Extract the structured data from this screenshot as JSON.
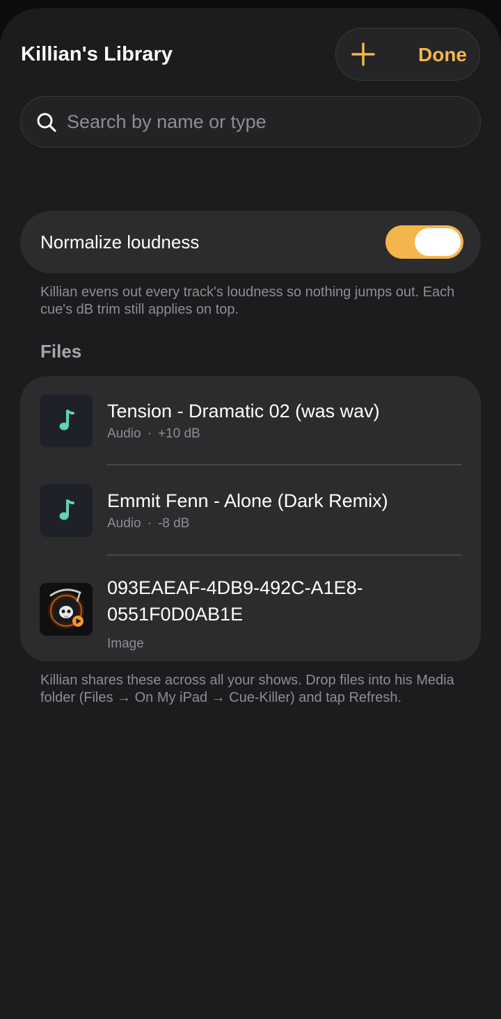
{
  "header": {
    "title": "Killian's Library",
    "add_icon": "plus-icon",
    "done_label": "Done"
  },
  "search": {
    "placeholder": "Search by name or type",
    "value": ""
  },
  "normalize": {
    "label": "Normalize loudness",
    "enabled": true,
    "footnote": "Killian evens out every track's loudness so nothing jumps out. Each cue's dB trim still applies on top."
  },
  "files": {
    "header": "Files",
    "items": [
      {
        "name": "Tension - Dramatic 02 (was wav)",
        "type": "Audio",
        "separator": "·",
        "gain": "+10 dB",
        "icon": "music-note-icon"
      },
      {
        "name": "Emmit Fenn - Alone (Dark Remix)",
        "type": "Audio",
        "separator": "·",
        "gain": "-8 dB",
        "icon": "music-note-icon"
      },
      {
        "name": "093EAEAF-4DB9-492C-A1E8-0551F0D0AB1E",
        "type": "Image",
        "icon": "image-thumbnail"
      }
    ],
    "footnote": "Killian shares these across all your shows. Drop files into his Media folder (Files → On My iPad → Cue-Killer) and tap Refresh."
  },
  "colors": {
    "accent": "#f5b54d",
    "note": "#5fd3b4",
    "background": "#1c1c1e",
    "card": "#2c2c2e"
  }
}
